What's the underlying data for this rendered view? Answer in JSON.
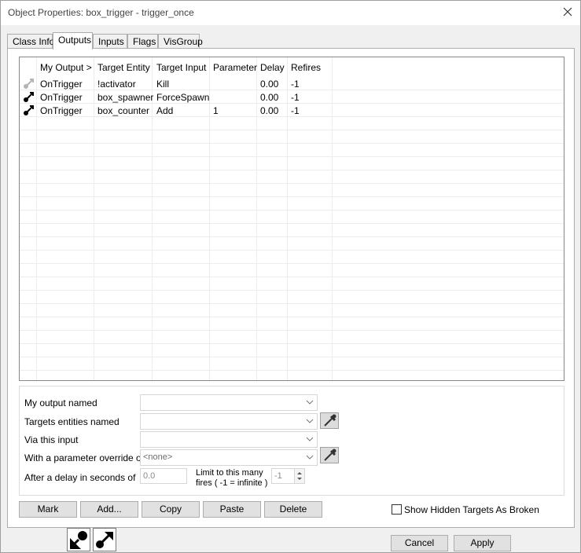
{
  "window": {
    "title": "Object Properties: box_trigger - trigger_once"
  },
  "tabs": [
    {
      "label": "Class Info"
    },
    {
      "label": "Outputs",
      "active": true
    },
    {
      "label": "Inputs"
    },
    {
      "label": "Flags"
    },
    {
      "label": "VisGroup"
    }
  ],
  "list": {
    "headers": [
      "My Output  >",
      "Target Entity",
      "Target Input",
      "Parameter",
      "Delay",
      "Refires"
    ],
    "rows": [
      {
        "icon": "output-connection-disabled-icon",
        "cells": [
          "OnTrigger",
          "!activator",
          "Kill",
          "",
          "0.00",
          "-1"
        ]
      },
      {
        "icon": "output-connection-icon",
        "cells": [
          "OnTrigger",
          "box_spawner",
          "ForceSpawn",
          "",
          "0.00",
          "-1"
        ]
      },
      {
        "icon": "output-connection-icon",
        "cells": [
          "OnTrigger",
          "box_counter",
          "Add",
          "1",
          "0.00",
          "-1"
        ]
      }
    ]
  },
  "editor": {
    "output_label": "My output named",
    "output_value": "",
    "targets_label": "Targets entities named",
    "targets_value": "",
    "input_label": "Via this input",
    "input_value": "",
    "param_label": "With a parameter override of",
    "param_value": "<none>",
    "delay_label": "After a delay in seconds of",
    "delay_value": "0.0",
    "limit_label_1": "Limit to this many",
    "limit_label_2": "fires ( -1 = infinite )",
    "limit_value": "-1"
  },
  "buttons": {
    "mark": "Mark",
    "add": "Add...",
    "copy": "Copy",
    "paste": "Paste",
    "delete": "Delete",
    "show_hidden": "Show Hidden Targets As Broken",
    "cancel": "Cancel",
    "apply": "Apply"
  },
  "colors": {
    "icon_dark": "#000000",
    "icon_disabled": "#b4b4b4",
    "grid_line": "#ececec",
    "dialog_bg": "#f0f0f0"
  }
}
